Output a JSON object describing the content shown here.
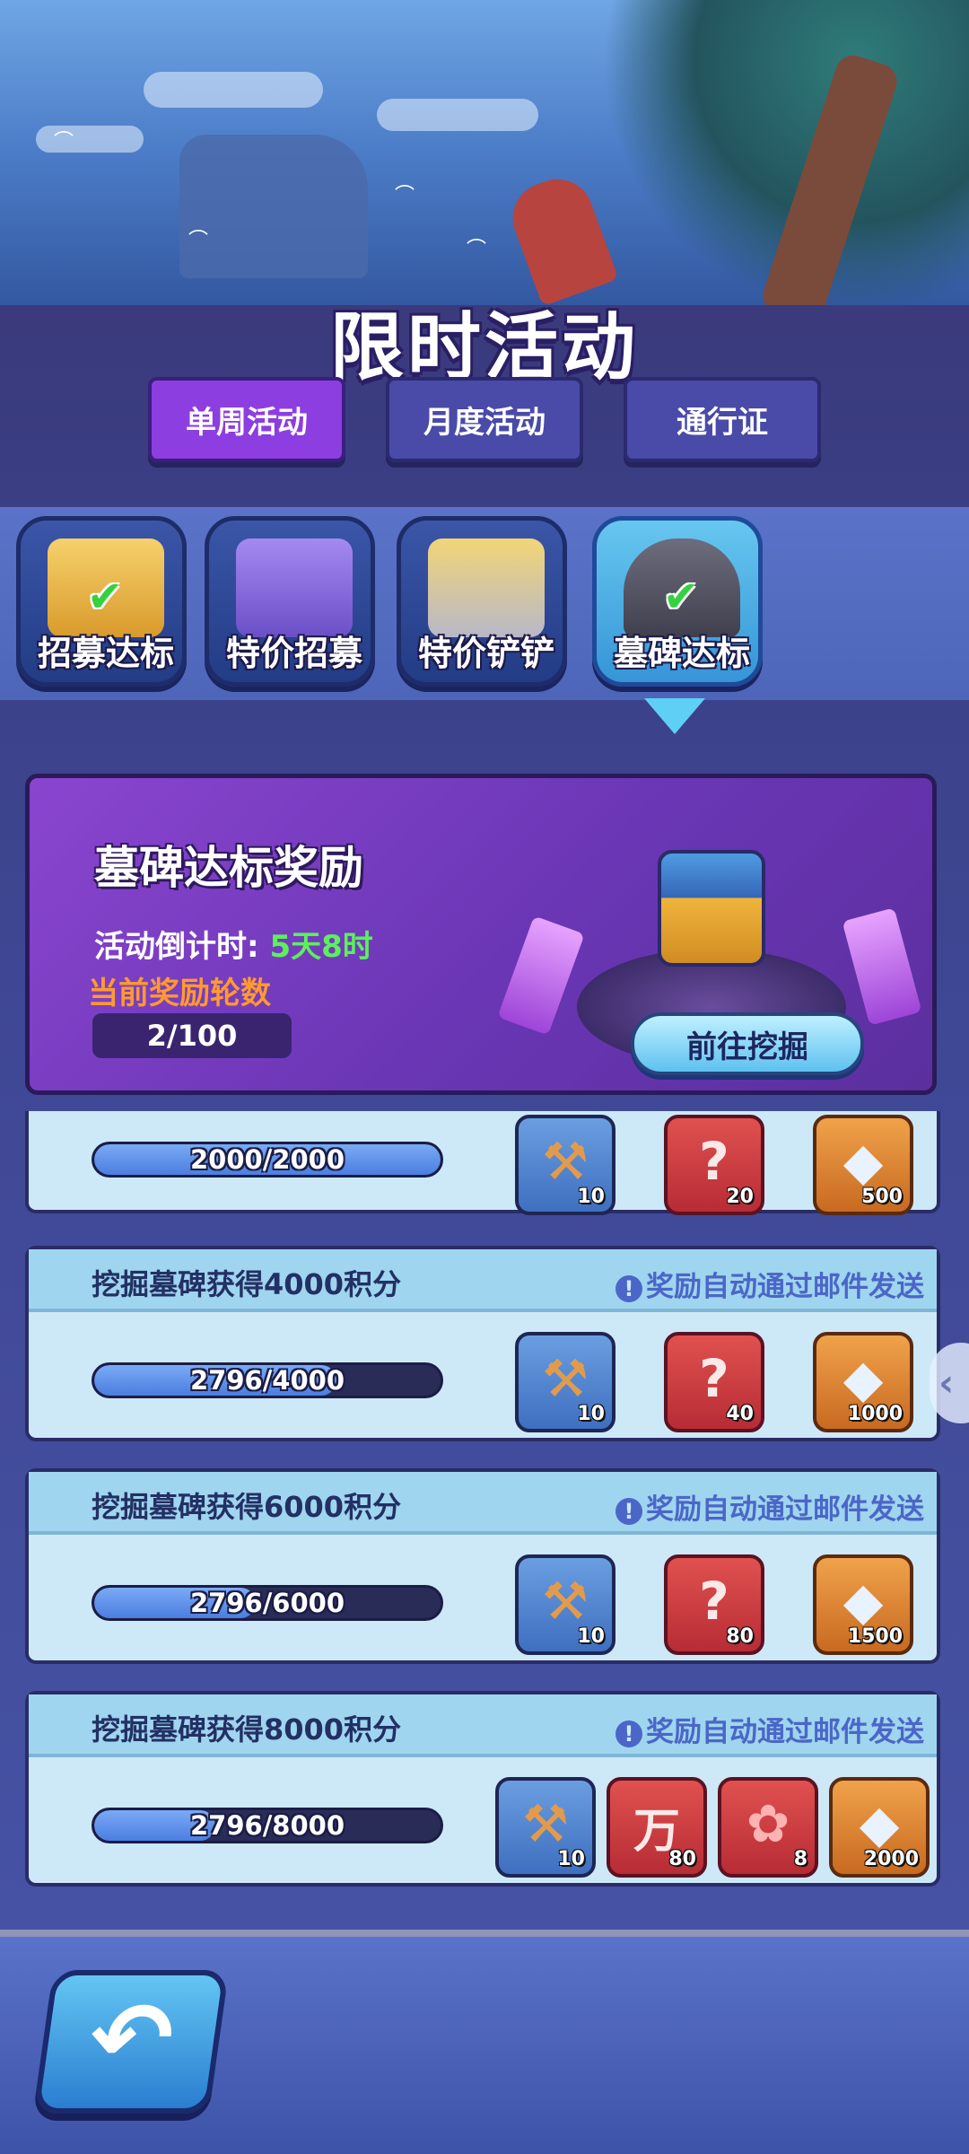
{
  "header": {
    "title": "限时活动",
    "tabs": [
      {
        "label": "单周活动",
        "active": true
      },
      {
        "label": "月度活动",
        "active": false
      },
      {
        "label": "通行证",
        "active": false
      }
    ]
  },
  "events": [
    {
      "label": "招募达标",
      "icon": "scroll-icon",
      "checked": true,
      "active": false
    },
    {
      "label": "特价招募",
      "icon": "monster-chest-icon",
      "checked": false,
      "active": false
    },
    {
      "label": "特价铲铲",
      "icon": "spatulas-icon",
      "checked": false,
      "active": false
    },
    {
      "label": "墓碑达标",
      "icon": "tombstone-icon",
      "checked": true,
      "active": true
    }
  ],
  "reward_header": {
    "title": "墓碑达标奖励",
    "countdown_label": "活动倒计时: ",
    "countdown_value": "5天8时",
    "round_label": "当前奖励轮数",
    "round_value": "2/100",
    "dig_button": "前往挖掘"
  },
  "rows": [
    {
      "title": "",
      "note": "",
      "progress_text": "2000/2000",
      "progress": 1.0,
      "items": [
        {
          "icon": "spatula-icon",
          "glyph": "⚒",
          "qty": "10",
          "style": "blue"
        },
        {
          "icon": "mystery-card-icon",
          "glyph": "?",
          "qty": "20",
          "style": "red"
        },
        {
          "icon": "diamond-icon",
          "glyph": "◆",
          "qty": "500",
          "style": "orange"
        }
      ]
    },
    {
      "title": "挖掘墓碑获得4000积分",
      "note": "奖励自动通过邮件发送",
      "progress_text": "2796/4000",
      "progress": 0.699,
      "items": [
        {
          "icon": "spatula-icon",
          "glyph": "⚒",
          "qty": "10",
          "style": "blue"
        },
        {
          "icon": "mystery-card-icon",
          "glyph": "?",
          "qty": "40",
          "style": "red"
        },
        {
          "icon": "diamond-icon",
          "glyph": "◆",
          "qty": "1000",
          "style": "orange"
        }
      ]
    },
    {
      "title": "挖掘墓碑获得6000积分",
      "note": "奖励自动通过邮件发送",
      "progress_text": "2796/6000",
      "progress": 0.466,
      "items": [
        {
          "icon": "spatula-icon",
          "glyph": "⚒",
          "qty": "10",
          "style": "blue"
        },
        {
          "icon": "mystery-card-icon",
          "glyph": "?",
          "qty": "80",
          "style": "red"
        },
        {
          "icon": "diamond-icon",
          "glyph": "◆",
          "qty": "1500",
          "style": "orange"
        }
      ]
    },
    {
      "title": "挖掘墓碑获得8000积分",
      "note": "奖励自动通过邮件发送",
      "progress_text": "2796/8000",
      "progress": 0.35,
      "items": [
        {
          "icon": "spatula-icon",
          "glyph": "⚒",
          "qty": "10",
          "style": "blue"
        },
        {
          "icon": "wan-card-icon",
          "glyph": "万",
          "qty": "80",
          "style": "red"
        },
        {
          "icon": "flower-icon",
          "glyph": "✿",
          "qty": "8",
          "style": "red"
        },
        {
          "icon": "diamond-icon",
          "glyph": "◆",
          "qty": "2000",
          "style": "orange"
        }
      ]
    }
  ],
  "footer": {
    "back_icon": "back-arrow-icon",
    "side_icon": "chevron-left-icon"
  }
}
